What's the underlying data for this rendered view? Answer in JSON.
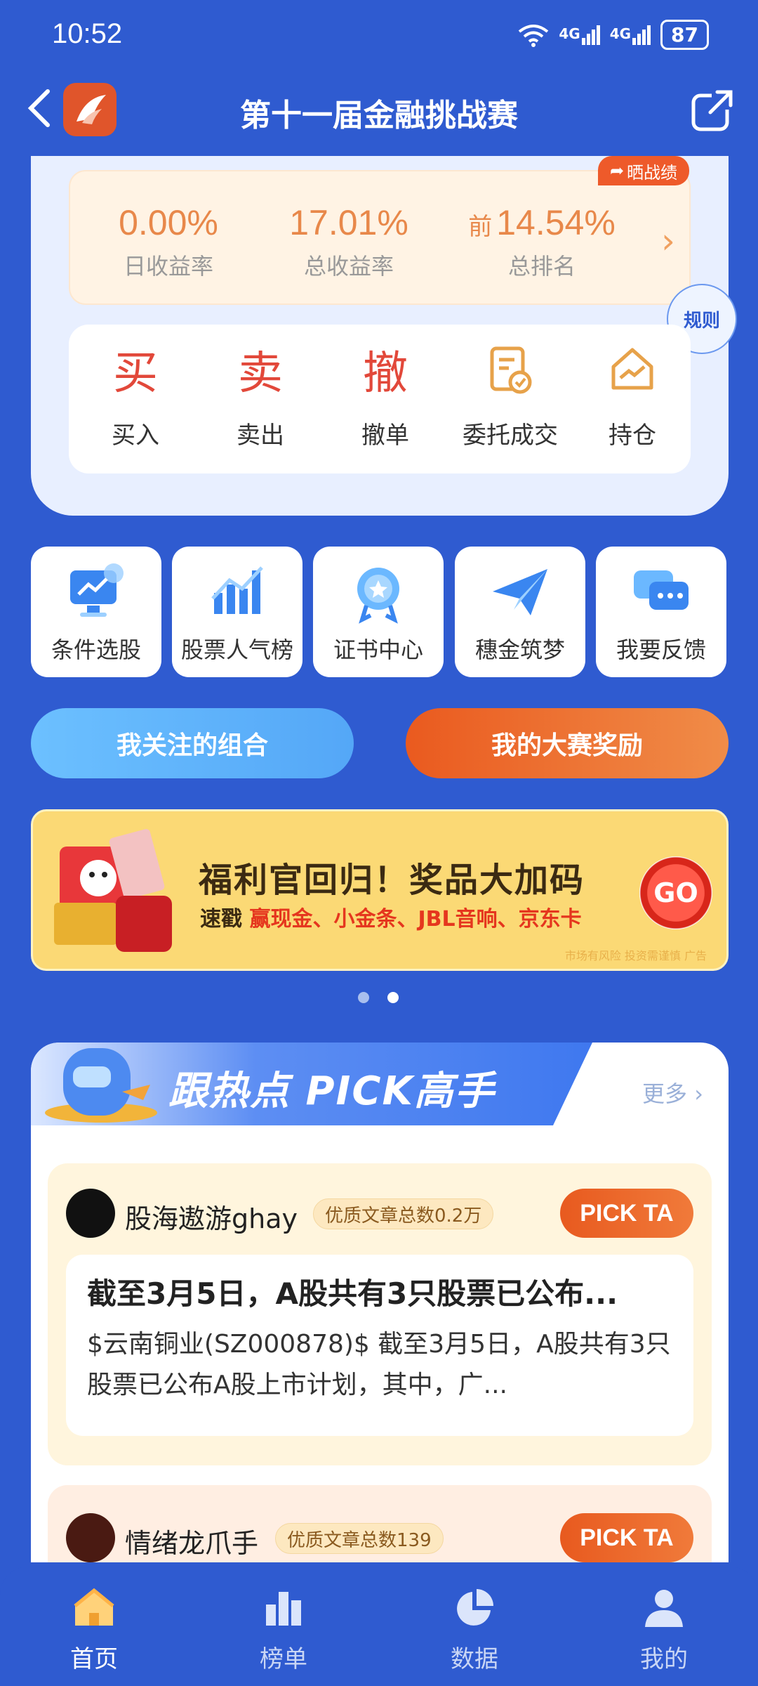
{
  "status_bar": {
    "time": "10:52",
    "network1": "4G",
    "network2": "4G",
    "battery": "87"
  },
  "header": {
    "title": "第十一届金融挑战赛"
  },
  "stats": {
    "show_badge": "晒战绩",
    "daily_return": {
      "value": "0.00%",
      "label": "日收益率"
    },
    "total_return": {
      "value": "17.01%",
      "label": "总收益率"
    },
    "rank": {
      "prefix": "前",
      "value": "14.54%",
      "label": "总排名"
    }
  },
  "rules_label": "规则",
  "trade_actions": [
    {
      "glyph": "买",
      "label": "买入",
      "color": "#e2483a"
    },
    {
      "glyph": "卖",
      "label": "卖出",
      "color": "#e2483a"
    },
    {
      "glyph": "撤",
      "label": "撤单",
      "color": "#e2483a"
    },
    {
      "glyph": "",
      "label": "委托成交",
      "icon": "document-check-icon"
    },
    {
      "glyph": "",
      "label": "持仓",
      "icon": "house-chart-icon"
    }
  ],
  "quick_tiles": [
    {
      "label": "条件选股",
      "icon": "monitor-chart-icon"
    },
    {
      "label": "股票人气榜",
      "icon": "bar-chart-icon"
    },
    {
      "label": "证书中心",
      "icon": "medal-icon"
    },
    {
      "label": "穗金筑梦",
      "icon": "paper-plane-icon"
    },
    {
      "label": "我要反馈",
      "icon": "chat-bubble-icon"
    }
  ],
  "buttons": {
    "followed": "我关注的组合",
    "rewards": "我的大赛奖励"
  },
  "banner": {
    "title": "福利官回归！奖品大加码",
    "sub_prefix": "速戳 ",
    "sub_highlight": "赢现金、小金条、JBL音响、京东卡",
    "go": "GO",
    "note": "市场有风险 投资需谨慎 广告"
  },
  "carousel": {
    "active_index": 1,
    "count": 2
  },
  "feed": {
    "title": "跟热点 PICK高手",
    "more": "更多",
    "posts": [
      {
        "username": "股海遨游ghay",
        "tag": "优质文章总数0.2万",
        "action": "PICK TA",
        "title": "截至3月5日，A股共有3只股票已公布...",
        "text": "$云南铜业(SZ000878)$      截至3月5日，A股共有3只股票已公布A股上市计划，其中，广..."
      },
      {
        "username": "情绪龙爪手",
        "tag": "优质文章总数139",
        "action": "PICK TA"
      }
    ]
  },
  "bottom_nav": [
    {
      "label": "首页",
      "icon": "home-icon",
      "active": true
    },
    {
      "label": "榜单",
      "icon": "ranking-icon",
      "active": false
    },
    {
      "label": "数据",
      "icon": "pie-chart-icon",
      "active": false
    },
    {
      "label": "我的",
      "icon": "user-icon",
      "active": false
    }
  ]
}
